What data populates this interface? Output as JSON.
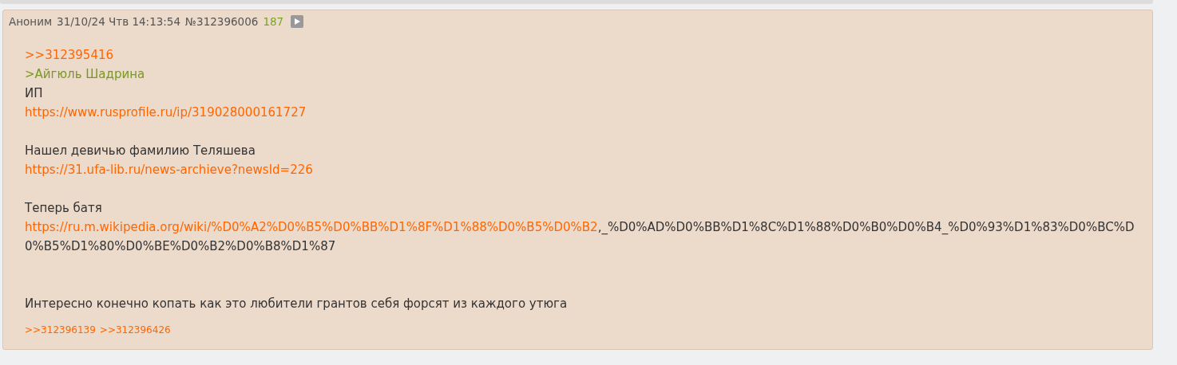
{
  "post": {
    "author": "Аноним",
    "date": "31/10/24 Чтв 14:13:54",
    "number": "№312396006",
    "count": "187",
    "lines": [
      {
        "kind": "reply",
        "text": ">>312395416"
      },
      {
        "kind": "quote",
        "text": ">Айгюль Шадрина"
      },
      {
        "kind": "text",
        "text": "ИП"
      },
      {
        "kind": "link",
        "text": "https://www.rusprofile.ru/ip/319028000161727"
      },
      {
        "kind": "blank"
      },
      {
        "kind": "text",
        "text": "Нашел девичью фамилию Теляшева"
      },
      {
        "kind": "link",
        "text": "https://31.ufa-lib.ru/news-archieve?newsId=226"
      },
      {
        "kind": "blank"
      },
      {
        "kind": "text",
        "text": "Теперь батя"
      },
      {
        "kind": "mixed",
        "text": "https://ru.m.wikipedia.org/wiki/%D0%A2%D0%B5%D0%BB%D1%8F%D1%88%D0%B5%D0%B2",
        "tail": ",_%D0%AD%D0%BB%D1%8C%D1%88%D0%B0%D0%B4_%D0%93%D1%83%D0%BC%D0%B5%D1%80%D0%BE%D0%B2%D0%B8%D1%87"
      },
      {
        "kind": "blank"
      },
      {
        "kind": "blank"
      },
      {
        "kind": "text",
        "text": "Интересно конечно копать как это любители грантов себя форсят из каждого утюга"
      }
    ],
    "replies": [
      ">>312396139",
      ">>312396426"
    ]
  }
}
